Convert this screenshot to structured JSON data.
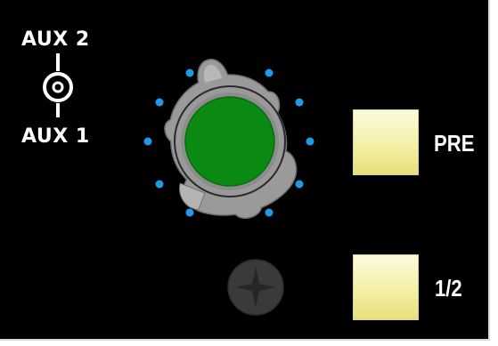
{
  "selector": {
    "top_label": "AUX 2",
    "bottom_label": "AUX 1",
    "icon": "toggle-switch-icon"
  },
  "knob": {
    "cap_color": "#0a8a12",
    "body_color": "#9a9a9a",
    "tick_color": "#1e9be8",
    "tick_count": 11
  },
  "buttons": {
    "pre_label": "PRE",
    "half_label": "1/2",
    "color": "#f3f0a6"
  },
  "screw": {
    "icon": "phillips-screw-icon"
  }
}
